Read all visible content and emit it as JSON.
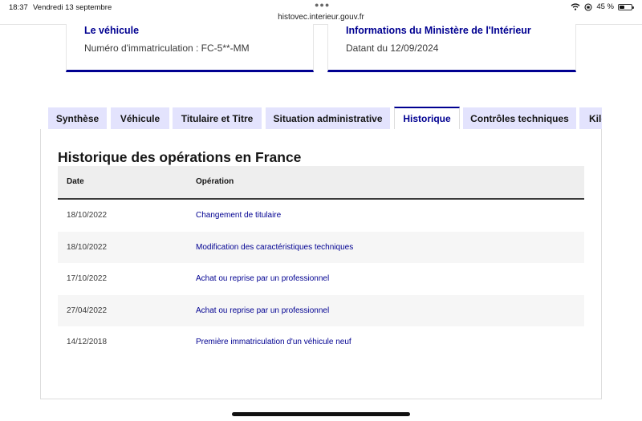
{
  "status_bar": {
    "time": "18:37",
    "date": "Vendredi 13 septembre",
    "url": "histovec.interieur.gouv.fr",
    "battery": "45 %",
    "battery_level": 0.45
  },
  "cards": {
    "vehicle": {
      "title": "Le véhicule",
      "text": "Numéro d'immatriculation : FC-5**-MM"
    },
    "ministry": {
      "title": "Informations du Ministère de l'Intérieur",
      "text": "Datant du 12/09/2024"
    }
  },
  "tabs": [
    {
      "label": "Synthèse"
    },
    {
      "label": "Véhicule"
    },
    {
      "label": "Titulaire et Titre"
    },
    {
      "label": "Situation administrative"
    },
    {
      "label": "Historique"
    },
    {
      "label": "Contrôles techniques"
    },
    {
      "label": "Kilométrage"
    }
  ],
  "active_tab": "Historique",
  "history": {
    "title": "Historique des opérations en France",
    "columns": {
      "date": "Date",
      "operation": "Opération"
    },
    "rows": [
      {
        "date": "18/10/2022",
        "operation": "Changement de titulaire"
      },
      {
        "date": "18/10/2022",
        "operation": "Modification des caractéristiques techniques"
      },
      {
        "date": "17/10/2022",
        "operation": "Achat ou reprise par un professionnel"
      },
      {
        "date": "27/04/2022",
        "operation": "Achat ou reprise par un professionnel"
      },
      {
        "date": "14/12/2018",
        "operation": "Première immatriculation d'un véhicule neuf"
      }
    ]
  },
  "colors": {
    "accent": "#000091",
    "tab_background": "#e3e3fd",
    "alt_row": "#f6f6f6",
    "header_row": "#eeeeee"
  }
}
